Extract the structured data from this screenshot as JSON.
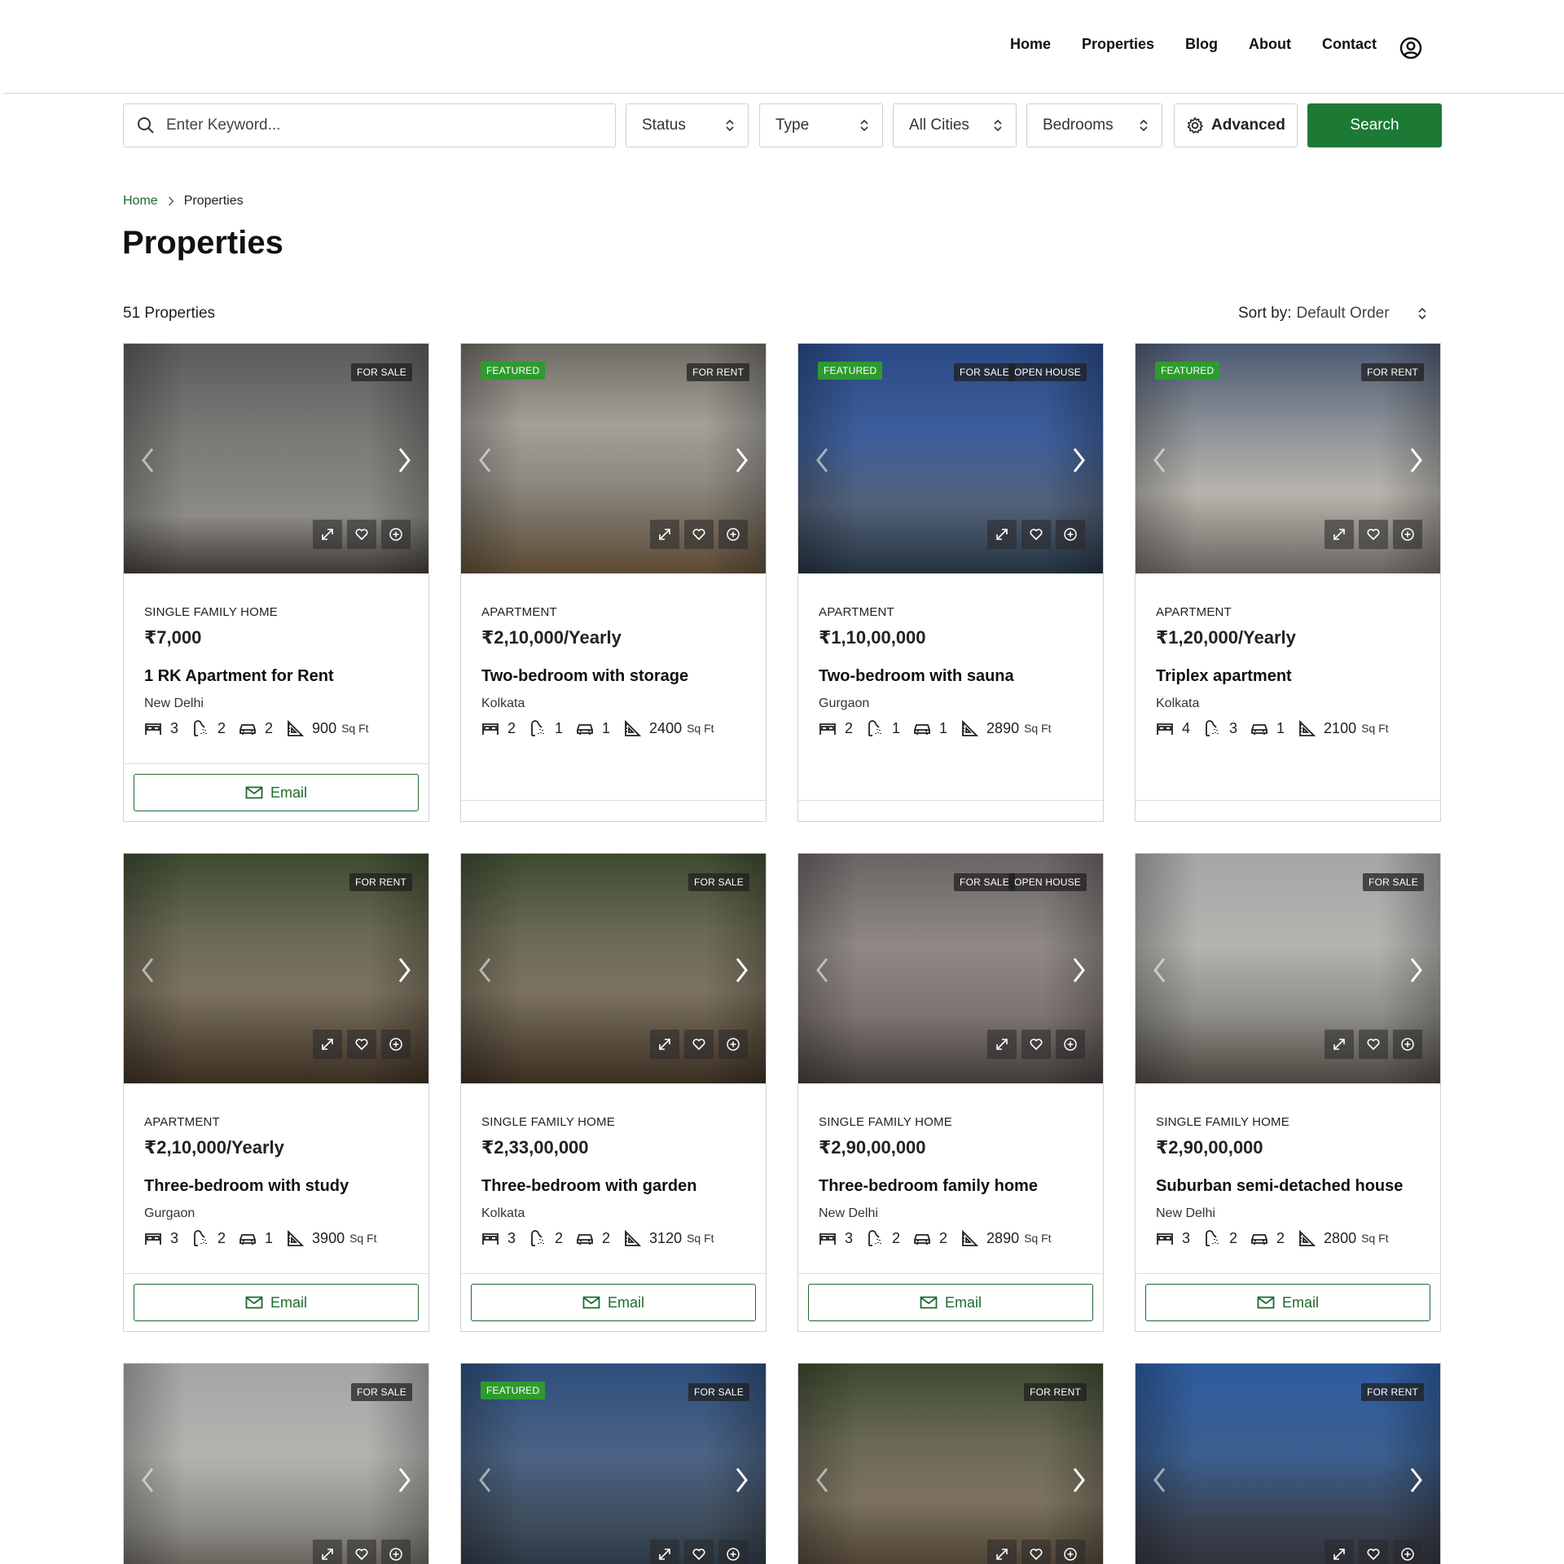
{
  "nav": {
    "links": [
      "Home",
      "Properties",
      "Blog",
      "About",
      "Contact"
    ],
    "user_icon": "user-circle-icon"
  },
  "search": {
    "keyword_placeholder": "Enter Keyword...",
    "status_label": "Status",
    "type_label": "Type",
    "cities_label": "All Cities",
    "bedrooms_label": "Bedrooms",
    "advanced_label": "Advanced",
    "search_label": "Search"
  },
  "breadcrumb": {
    "home": "Home",
    "current": "Properties"
  },
  "page": {
    "title": "Properties",
    "count": "51 Properties",
    "sort_label": "Sort by:",
    "sort_value": "Default Order"
  },
  "colors": {
    "accent": "#1c7a34",
    "featured": "#2e9b2e"
  },
  "listings": [
    {
      "type": "SINGLE FAMILY HOME",
      "price": "₹7,000",
      "title": "1 RK Apartment for Rent",
      "city": "New Delhi",
      "beds": "3",
      "baths": "2",
      "garage": "2",
      "area": "900",
      "unit": "Sq Ft",
      "tags": [
        "FOR SALE"
      ],
      "featured": "",
      "email": "Email"
    },
    {
      "type": "APARTMENT",
      "price": "₹2,10,000/Yearly",
      "title": "Two-bedroom with storage",
      "city": "Kolkata",
      "beds": "2",
      "baths": "1",
      "garage": "1",
      "area": "2400",
      "unit": "Sq Ft",
      "tags": [
        "FOR RENT"
      ],
      "featured": "FEATURED",
      "email": ""
    },
    {
      "type": "APARTMENT",
      "price": "₹1,10,00,000",
      "title": "Two-bedroom with sauna",
      "city": "Gurgaon",
      "beds": "2",
      "baths": "1",
      "garage": "1",
      "area": "2890",
      "unit": "Sq Ft",
      "tags": [
        "FOR SALE",
        "OPEN HOUSE"
      ],
      "featured": "FEATURED",
      "email": ""
    },
    {
      "type": "APARTMENT",
      "price": "₹1,20,000/Yearly",
      "title": "Triplex apartment",
      "city": "Kolkata",
      "beds": "4",
      "baths": "3",
      "garage": "1",
      "area": "2100",
      "unit": "Sq Ft",
      "tags": [
        "FOR RENT"
      ],
      "featured": "FEATURED",
      "email": ""
    },
    {
      "type": "APARTMENT",
      "price": "₹2,10,000/Yearly",
      "title": "Three-bedroom with study",
      "city": "Gurgaon",
      "beds": "3",
      "baths": "2",
      "garage": "1",
      "area": "3900",
      "unit": "Sq Ft",
      "tags": [
        "FOR RENT"
      ],
      "featured": "",
      "email": "Email"
    },
    {
      "type": "SINGLE FAMILY HOME",
      "price": "₹2,33,00,000",
      "title": "Three-bedroom with garden",
      "city": "Kolkata",
      "beds": "3",
      "baths": "2",
      "garage": "2",
      "area": "3120",
      "unit": "Sq Ft",
      "tags": [
        "FOR SALE"
      ],
      "featured": "",
      "email": "Email"
    },
    {
      "type": "SINGLE FAMILY HOME",
      "price": "₹2,90,00,000",
      "title": "Three-bedroom family home",
      "city": "New Delhi",
      "beds": "3",
      "baths": "2",
      "garage": "2",
      "area": "2890",
      "unit": "Sq Ft",
      "tags": [
        "FOR SALE",
        "OPEN HOUSE"
      ],
      "featured": "",
      "email": "Email"
    },
    {
      "type": "SINGLE FAMILY HOME",
      "price": "₹2,90,00,000",
      "title": "Suburban semi-detached house",
      "city": "New Delhi",
      "beds": "3",
      "baths": "2",
      "garage": "2",
      "area": "2800",
      "unit": "Sq Ft",
      "tags": [
        "FOR SALE"
      ],
      "featured": "",
      "email": "Email"
    },
    {
      "tags": [
        "FOR SALE"
      ],
      "featured": ""
    },
    {
      "tags": [
        "FOR SALE"
      ],
      "featured": "FEATURED"
    },
    {
      "tags": [
        "FOR RENT"
      ],
      "featured": ""
    },
    {
      "tags": [
        "FOR RENT"
      ],
      "featured": ""
    }
  ]
}
